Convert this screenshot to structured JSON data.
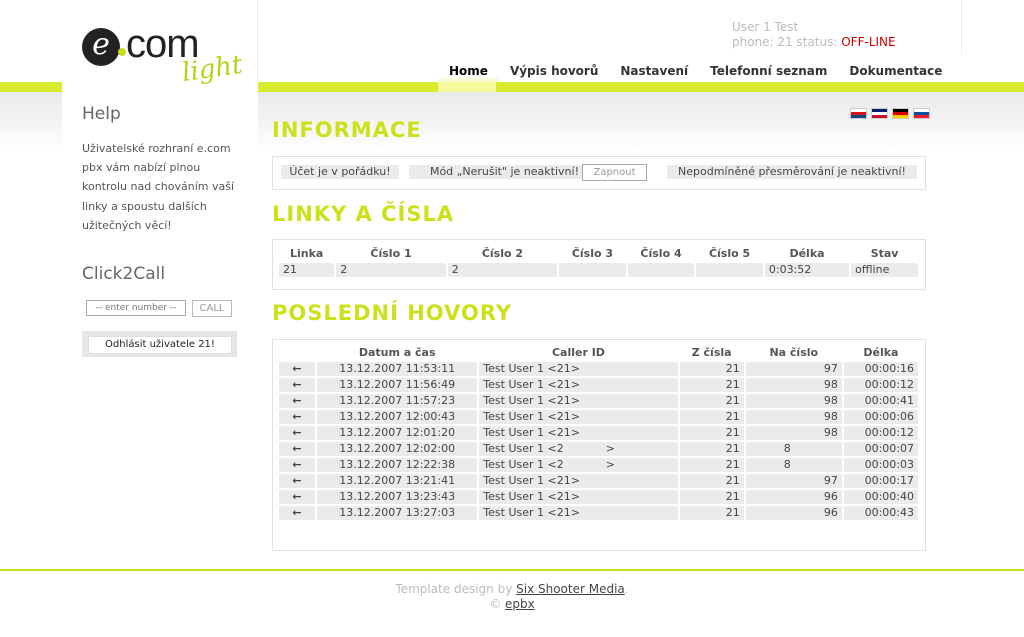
{
  "logo": {
    "e": "e",
    "com": "com",
    "light": "light"
  },
  "user": {
    "name": "User 1 Test",
    "phone_line_prefix": "phone: 21 status: ",
    "status": "OFF-LINE"
  },
  "nav": [
    "Home",
    "Výpis hovorů",
    "Nastavení",
    "Telefonní seznam",
    "Dokumentace"
  ],
  "flags": [
    {
      "name": "czech-flag-icon",
      "colors": [
        "#ffffff",
        "#d7141a",
        "#11457e"
      ]
    },
    {
      "name": "uk-flag-icon",
      "colors": [
        "#012169",
        "#ffffff",
        "#c8102e"
      ]
    },
    {
      "name": "german-flag-icon",
      "colors": [
        "#000000",
        "#dd0000",
        "#ffce00"
      ]
    },
    {
      "name": "slovak-flag-icon",
      "colors": [
        "#ffffff",
        "#0b4ea2",
        "#ee1c25"
      ]
    }
  ],
  "sidebar": {
    "help_title": "Help",
    "help_text": "Uživatelské rozhraní e.com pbx vám nabízí plnou kontrolu nad chováním vaší linky a spoustu dalších užitečných věcí!",
    "click2call_title": "Click2Call",
    "click2call_placeholder": "-- enter number --",
    "call_button": "CALL",
    "logout_button": "Odhlásit uživatele 21!"
  },
  "informace": {
    "title": "INFORMACE",
    "account": "Účet je v pořádku!",
    "dnd": "Mód „Nerušit\" je neaktivní!",
    "dnd_button": "Zapnout",
    "forward": "Nepodmíněné přesměrování je neaktivní!"
  },
  "linky": {
    "title": "LINKY A ČÍSLA",
    "headers": [
      "Linka",
      "Číslo 1",
      "Číslo 2",
      "Číslo 3",
      "Číslo 4",
      "Číslo 5",
      "Délka",
      "Stav"
    ],
    "row": [
      "21",
      "2",
      "2",
      "",
      "",
      "",
      "0:03:52",
      "offline"
    ]
  },
  "hovory": {
    "title": "POSLEDNÍ HOVORY",
    "headers": [
      "Datum a čas",
      "Caller ID",
      "Z čísla",
      "Na číslo",
      "Délka"
    ],
    "rows": [
      [
        "13.12.2007 11:53:11",
        "Test User 1 <21>",
        "21",
        "97",
        "00:00:16"
      ],
      [
        "13.12.2007 11:56:49",
        "Test User 1 <21>",
        "21",
        "98",
        "00:00:12"
      ],
      [
        "13.12.2007 11:57:23",
        "Test User 1 <21>",
        "21",
        "98",
        "00:00:41"
      ],
      [
        "13.12.2007 12:00:43",
        "Test User 1 <21>",
        "21",
        "98",
        "00:00:06"
      ],
      [
        "13.12.2007 12:01:20",
        "Test User 1 <21>",
        "21",
        "98",
        "00:00:12"
      ],
      [
        "13.12.2007 12:02:00",
        "Test User 1 <2            >",
        "21",
        "8",
        "00:00:07"
      ],
      [
        "13.12.2007 12:22:38",
        "Test User 1 <2            >",
        "21",
        "8",
        "00:00:03"
      ],
      [
        "13.12.2007 13:21:41",
        "Test User 1 <21>",
        "21",
        "97",
        "00:00:17"
      ],
      [
        "13.12.2007 13:23:43",
        "Test User 1 <21>",
        "21",
        "96",
        "00:00:40"
      ],
      [
        "13.12.2007 13:27:03",
        "Test User 1 <21>",
        "21",
        "96",
        "00:00:43"
      ]
    ]
  },
  "footer": {
    "line1_prefix": "Template design by ",
    "line1_link": "Six Shooter Media",
    "line1_suffix": ".",
    "copyright": "© ",
    "line2_link": "epbx"
  }
}
